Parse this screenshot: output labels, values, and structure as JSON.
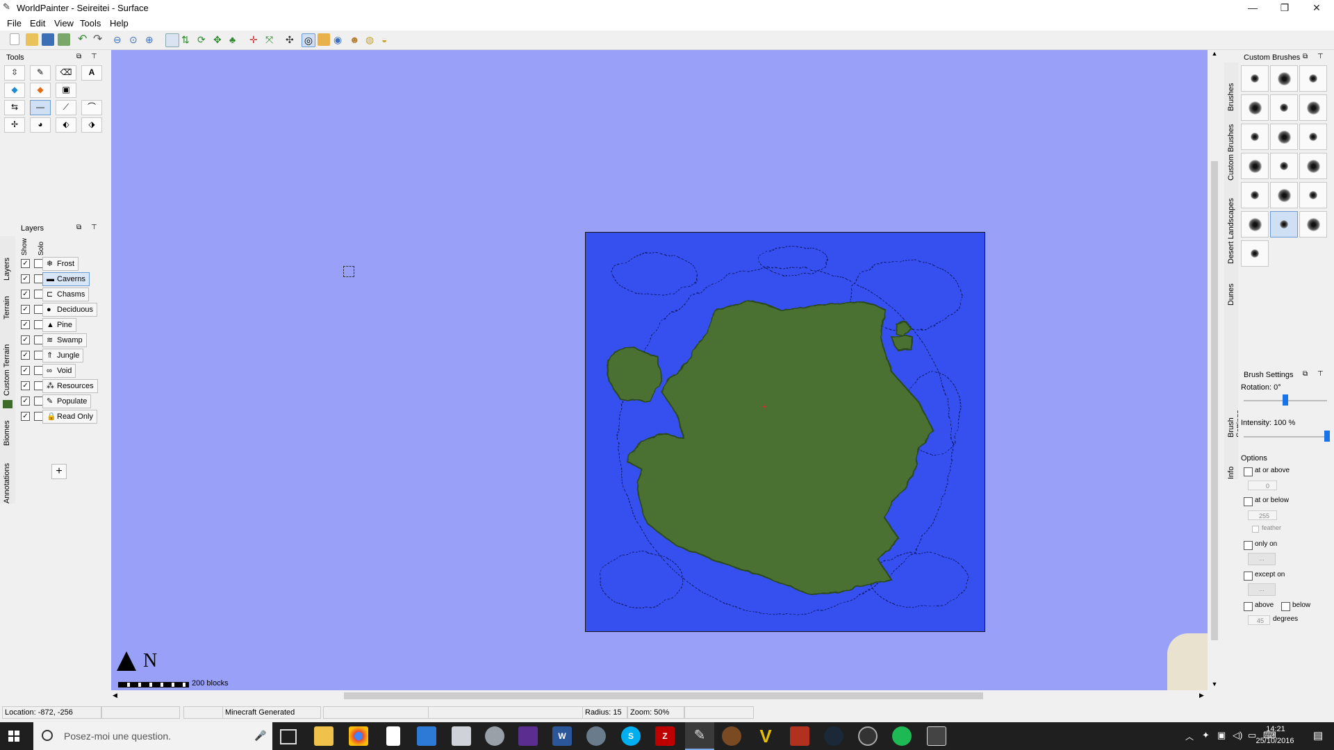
{
  "window": {
    "title": "WorldPainter - Seireitei - Surface",
    "controls": [
      "—",
      "❐",
      "✕"
    ]
  },
  "menu": [
    "File",
    "Edit",
    "View",
    "Tools",
    "Help"
  ],
  "tools_panel": {
    "title": "Tools"
  },
  "layers_panel": {
    "title": "Layers",
    "col_show": "Show",
    "col_solo": "Solo",
    "items": [
      {
        "label": "Frost",
        "icon": "❄",
        "show": true,
        "solo": false
      },
      {
        "label": "Caverns",
        "icon": "▬",
        "show": true,
        "solo": false
      },
      {
        "label": "Chasms",
        "icon": "⊏",
        "show": true,
        "solo": false
      },
      {
        "label": "Deciduous",
        "icon": "●",
        "show": true,
        "solo": false
      },
      {
        "label": "Pine",
        "icon": "▲",
        "show": true,
        "solo": false
      },
      {
        "label": "Swamp",
        "icon": "≋",
        "show": true,
        "solo": false
      },
      {
        "label": "Jungle",
        "icon": "⇑",
        "show": true,
        "solo": false
      },
      {
        "label": "Void",
        "icon": "∞",
        "show": true,
        "solo": false
      },
      {
        "label": "Resources",
        "icon": "⁂",
        "show": true,
        "solo": false
      },
      {
        "label": "Populate",
        "icon": "✎",
        "show": true,
        "solo": false
      },
      {
        "label": "Read Only",
        "icon": "🔒",
        "show": true,
        "solo": false
      }
    ],
    "add_label": "+"
  },
  "left_tabs": [
    "Layers",
    "Terrain",
    "Custom Terrain",
    "Biomes",
    "Annotations"
  ],
  "map": {
    "scale_label": "200 blocks",
    "north_label": "N"
  },
  "right_tabs_top": [
    "Brushes",
    "Custom Brushes",
    "Desert Landscapes",
    "Dunes"
  ],
  "right_tabs_bottom": [
    "Brush Settings",
    "Info"
  ],
  "custom_brushes": {
    "title": "Custom Brushes"
  },
  "brush_settings": {
    "title": "Brush Settings",
    "rotation_label": "Rotation: 0°",
    "rotation_value": 0.5,
    "intensity_label": "Intensity: 100 %",
    "intensity_value": 1.0,
    "options_label": "Options",
    "at_or_above": "at or above",
    "at_or_above_value": "0",
    "at_or_below": "at or below",
    "at_or_below_value": "255",
    "feather": "feather",
    "only_on": "only on",
    "only_on_btn": "...",
    "except_on": "except on",
    "except_on_btn": "...",
    "above": "above",
    "below": "below",
    "degrees_value": "45",
    "degrees": "degrees"
  },
  "statusbar": {
    "location": "Location: -872, -256",
    "source": "Minecraft Generated",
    "radius": "Radius: 15",
    "zoom": "Zoom: 50%"
  },
  "taskbar": {
    "search_placeholder": "Posez-moi une question.",
    "time": "14:21",
    "date": "25/10/2016"
  },
  "colors": {
    "map_background": "#98a0f8",
    "water": "#3550ee",
    "land": "#4c7132",
    "taskbar": "#1f1f1f"
  }
}
